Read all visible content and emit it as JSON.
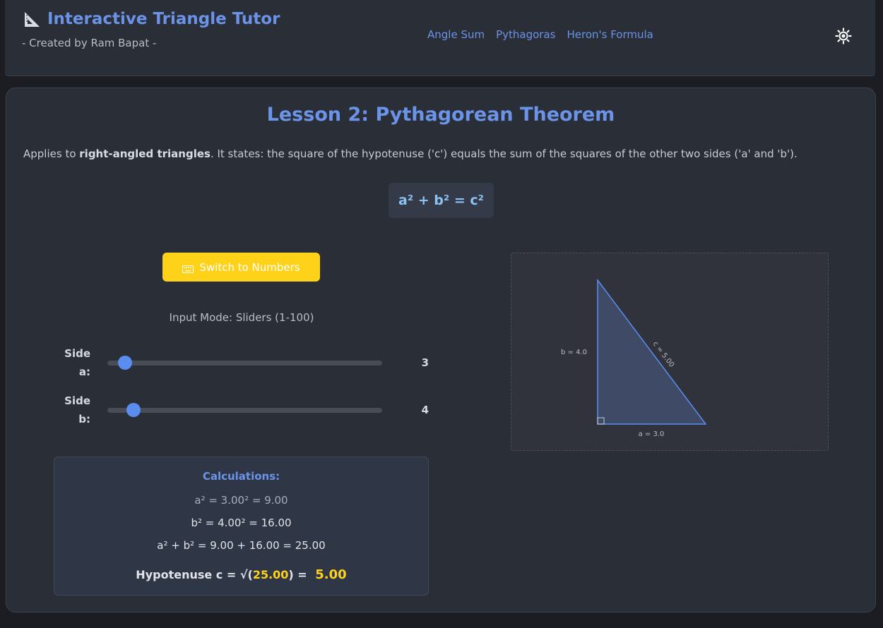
{
  "header": {
    "title": "Interactive Triangle Tutor",
    "subtitle": "- Created by Ram Bapat -",
    "nav": [
      "Angle Sum",
      "Pythagoras",
      "Heron's Formula"
    ]
  },
  "lesson": {
    "title": "Lesson 2: Pythagorean Theorem",
    "desc_pre": "Applies to ",
    "desc_bold": "right-angled triangles",
    "desc_post": ". It states: the square of the hypotenuse ('c') equals the sum of the squares of the other two sides ('a' and 'b').",
    "formula": "a² + b² = c²"
  },
  "controls": {
    "switch_label": "Switch to Numbers",
    "input_mode": "Input Mode: Sliders (1-100)",
    "sliders": [
      {
        "label_line1": "Side",
        "label_line2": "a:",
        "value": 3,
        "min": 1,
        "max": 100
      },
      {
        "label_line1": "Side",
        "label_line2": "b:",
        "value": 4,
        "min": 1,
        "max": 100
      }
    ]
  },
  "calculations": {
    "title": "Calculations:",
    "line_a": "a² = 3.00² = 9.00",
    "line_b": "b² = 4.00² = 16.00",
    "line_sum": "a² + b² = 9.00 + 16.00 = 25.00",
    "hyp_prefix": "Hypotenuse c = √(",
    "hyp_inner": "25.00",
    "hyp_suffix": ") = ",
    "hyp_result": "5.00"
  },
  "diagram": {
    "label_a": "a = 3.0",
    "label_b": "b = 4.0",
    "label_c": "c = 5.00"
  },
  "colors": {
    "accent": "#6b93e8",
    "highlight": "#ffd21a",
    "slider": "#5b8def",
    "triangle_stroke": "#5b8def"
  }
}
